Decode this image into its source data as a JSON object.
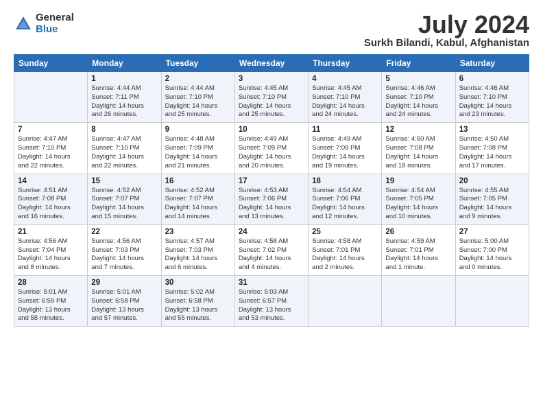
{
  "header": {
    "logo_general": "General",
    "logo_blue": "Blue",
    "month_title": "July 2024",
    "location": "Surkh Bilandi, Kabul, Afghanistan"
  },
  "weekdays": [
    "Sunday",
    "Monday",
    "Tuesday",
    "Wednesday",
    "Thursday",
    "Friday",
    "Saturday"
  ],
  "weeks": [
    [
      {
        "day": "",
        "info": ""
      },
      {
        "day": "1",
        "info": "Sunrise: 4:44 AM\nSunset: 7:11 PM\nDaylight: 14 hours\nand 26 minutes."
      },
      {
        "day": "2",
        "info": "Sunrise: 4:44 AM\nSunset: 7:10 PM\nDaylight: 14 hours\nand 25 minutes."
      },
      {
        "day": "3",
        "info": "Sunrise: 4:45 AM\nSunset: 7:10 PM\nDaylight: 14 hours\nand 25 minutes."
      },
      {
        "day": "4",
        "info": "Sunrise: 4:45 AM\nSunset: 7:10 PM\nDaylight: 14 hours\nand 24 minutes."
      },
      {
        "day": "5",
        "info": "Sunrise: 4:46 AM\nSunset: 7:10 PM\nDaylight: 14 hours\nand 24 minutes."
      },
      {
        "day": "6",
        "info": "Sunrise: 4:46 AM\nSunset: 7:10 PM\nDaylight: 14 hours\nand 23 minutes."
      }
    ],
    [
      {
        "day": "7",
        "info": "Sunrise: 4:47 AM\nSunset: 7:10 PM\nDaylight: 14 hours\nand 22 minutes."
      },
      {
        "day": "8",
        "info": "Sunrise: 4:47 AM\nSunset: 7:10 PM\nDaylight: 14 hours\nand 22 minutes."
      },
      {
        "day": "9",
        "info": "Sunrise: 4:48 AM\nSunset: 7:09 PM\nDaylight: 14 hours\nand 21 minutes."
      },
      {
        "day": "10",
        "info": "Sunrise: 4:49 AM\nSunset: 7:09 PM\nDaylight: 14 hours\nand 20 minutes."
      },
      {
        "day": "11",
        "info": "Sunrise: 4:49 AM\nSunset: 7:09 PM\nDaylight: 14 hours\nand 19 minutes."
      },
      {
        "day": "12",
        "info": "Sunrise: 4:50 AM\nSunset: 7:08 PM\nDaylight: 14 hours\nand 18 minutes."
      },
      {
        "day": "13",
        "info": "Sunrise: 4:50 AM\nSunset: 7:08 PM\nDaylight: 14 hours\nand 17 minutes."
      }
    ],
    [
      {
        "day": "14",
        "info": "Sunrise: 4:51 AM\nSunset: 7:08 PM\nDaylight: 14 hours\nand 16 minutes."
      },
      {
        "day": "15",
        "info": "Sunrise: 4:52 AM\nSunset: 7:07 PM\nDaylight: 14 hours\nand 15 minutes."
      },
      {
        "day": "16",
        "info": "Sunrise: 4:52 AM\nSunset: 7:07 PM\nDaylight: 14 hours\nand 14 minutes."
      },
      {
        "day": "17",
        "info": "Sunrise: 4:53 AM\nSunset: 7:06 PM\nDaylight: 14 hours\nand 13 minutes."
      },
      {
        "day": "18",
        "info": "Sunrise: 4:54 AM\nSunset: 7:06 PM\nDaylight: 14 hours\nand 12 minutes."
      },
      {
        "day": "19",
        "info": "Sunrise: 4:54 AM\nSunset: 7:05 PM\nDaylight: 14 hours\nand 10 minutes."
      },
      {
        "day": "20",
        "info": "Sunrise: 4:55 AM\nSunset: 7:05 PM\nDaylight: 14 hours\nand 9 minutes."
      }
    ],
    [
      {
        "day": "21",
        "info": "Sunrise: 4:56 AM\nSunset: 7:04 PM\nDaylight: 14 hours\nand 8 minutes."
      },
      {
        "day": "22",
        "info": "Sunrise: 4:56 AM\nSunset: 7:03 PM\nDaylight: 14 hours\nand 7 minutes."
      },
      {
        "day": "23",
        "info": "Sunrise: 4:57 AM\nSunset: 7:03 PM\nDaylight: 14 hours\nand 6 minutes."
      },
      {
        "day": "24",
        "info": "Sunrise: 4:58 AM\nSunset: 7:02 PM\nDaylight: 14 hours\nand 4 minutes."
      },
      {
        "day": "25",
        "info": "Sunrise: 4:58 AM\nSunset: 7:01 PM\nDaylight: 14 hours\nand 2 minutes."
      },
      {
        "day": "26",
        "info": "Sunrise: 4:59 AM\nSunset: 7:01 PM\nDaylight: 14 hours\nand 1 minute."
      },
      {
        "day": "27",
        "info": "Sunrise: 5:00 AM\nSunset: 7:00 PM\nDaylight: 14 hours\nand 0 minutes."
      }
    ],
    [
      {
        "day": "28",
        "info": "Sunrise: 5:01 AM\nSunset: 6:59 PM\nDaylight: 13 hours\nand 58 minutes."
      },
      {
        "day": "29",
        "info": "Sunrise: 5:01 AM\nSunset: 6:58 PM\nDaylight: 13 hours\nand 57 minutes."
      },
      {
        "day": "30",
        "info": "Sunrise: 5:02 AM\nSunset: 6:58 PM\nDaylight: 13 hours\nand 55 minutes."
      },
      {
        "day": "31",
        "info": "Sunrise: 5:03 AM\nSunset: 6:57 PM\nDaylight: 13 hours\nand 53 minutes."
      },
      {
        "day": "",
        "info": ""
      },
      {
        "day": "",
        "info": ""
      },
      {
        "day": "",
        "info": ""
      }
    ]
  ]
}
